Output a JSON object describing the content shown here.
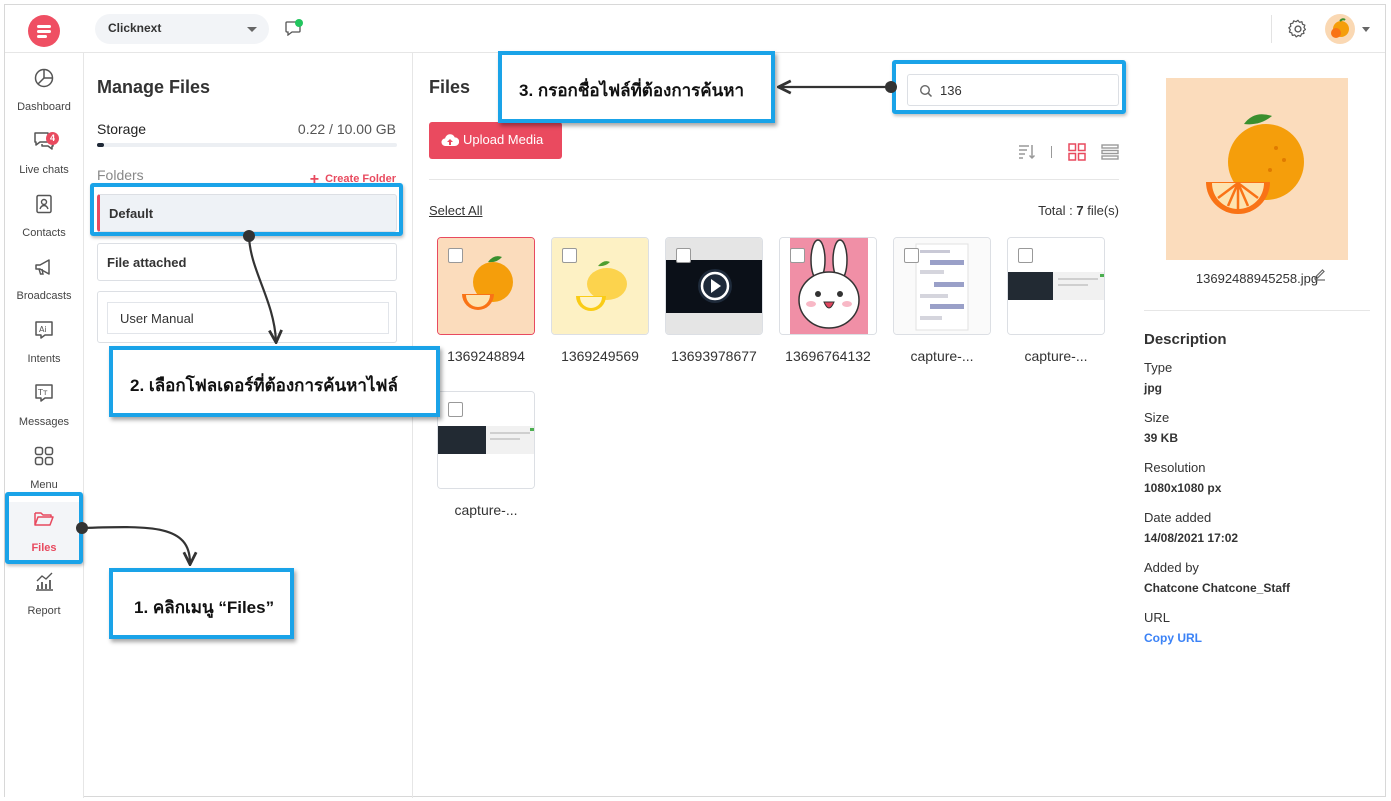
{
  "topbar": {
    "workspace": "Clicknext",
    "colors": {
      "brand": "#ef4f63",
      "online": "#22c55e"
    }
  },
  "sidebar": {
    "items": [
      {
        "label": "Dashboard",
        "icon": "pie-chart-icon"
      },
      {
        "label": "Live chats",
        "icon": "chat-bubbles-icon",
        "badge": "4"
      },
      {
        "label": "Contacts",
        "icon": "contact-book-icon"
      },
      {
        "label": "Broadcasts",
        "icon": "megaphone-icon"
      },
      {
        "label": "Intents",
        "icon": "ai-icon"
      },
      {
        "label": "Messages",
        "icon": "text-message-icon"
      },
      {
        "label": "Menu",
        "icon": "grid-menu-icon"
      },
      {
        "label": "Files",
        "icon": "folder-open-icon",
        "active": true
      },
      {
        "label": "Report",
        "icon": "bar-chart-icon"
      }
    ]
  },
  "manage": {
    "title": "Manage Files",
    "storage_label": "Storage",
    "storage_value": "0.22 / 10.00 GB",
    "storage_used_fraction": 0.022,
    "folders_label": "Folders",
    "create_folder": "Create Folder",
    "folders": [
      "Default",
      "File attached",
      "User Manual"
    ]
  },
  "files": {
    "title": "Files",
    "search_value": "136",
    "upload_label": "Upload Media",
    "select_all": "Select All",
    "total_prefix": "Total : ",
    "total_count": "7",
    "total_suffix": " file(s)",
    "items": [
      {
        "name": "1369248894",
        "thumb": "orange"
      },
      {
        "name": "1369249569",
        "thumb": "lemon"
      },
      {
        "name": "13693978677",
        "thumb": "video"
      },
      {
        "name": "13696764132",
        "thumb": "bunny"
      },
      {
        "name": "capture-...",
        "thumb": "chat-capture"
      },
      {
        "name": "capture-...",
        "thumb": "screen-capture"
      },
      {
        "name": "capture-...",
        "thumb": "screen-capture"
      }
    ]
  },
  "detail": {
    "filename": "13692488945258.jpg",
    "description_title": "Description",
    "fields": [
      {
        "label": "Type",
        "value": "jpg"
      },
      {
        "label": "Size",
        "value": "39 KB"
      },
      {
        "label": "Resolution",
        "value": "1080x1080 px"
      },
      {
        "label": "Date added",
        "value": "14/08/2021 17:02"
      },
      {
        "label": "Added by",
        "value": "Chatcone Chatcone_Staff"
      },
      {
        "label": "URL",
        "value": "Copy URL"
      }
    ]
  },
  "annotations": {
    "step1": "1. คลิกเมนู “Files”",
    "step2": "2. เลือกโฟลเดอร์ที่ต้องการค้นหาไฟล์",
    "step3": "3. กรอกชื่อไฟล์ที่ต้องการค้นหา",
    "color": "#1aa3e8"
  }
}
